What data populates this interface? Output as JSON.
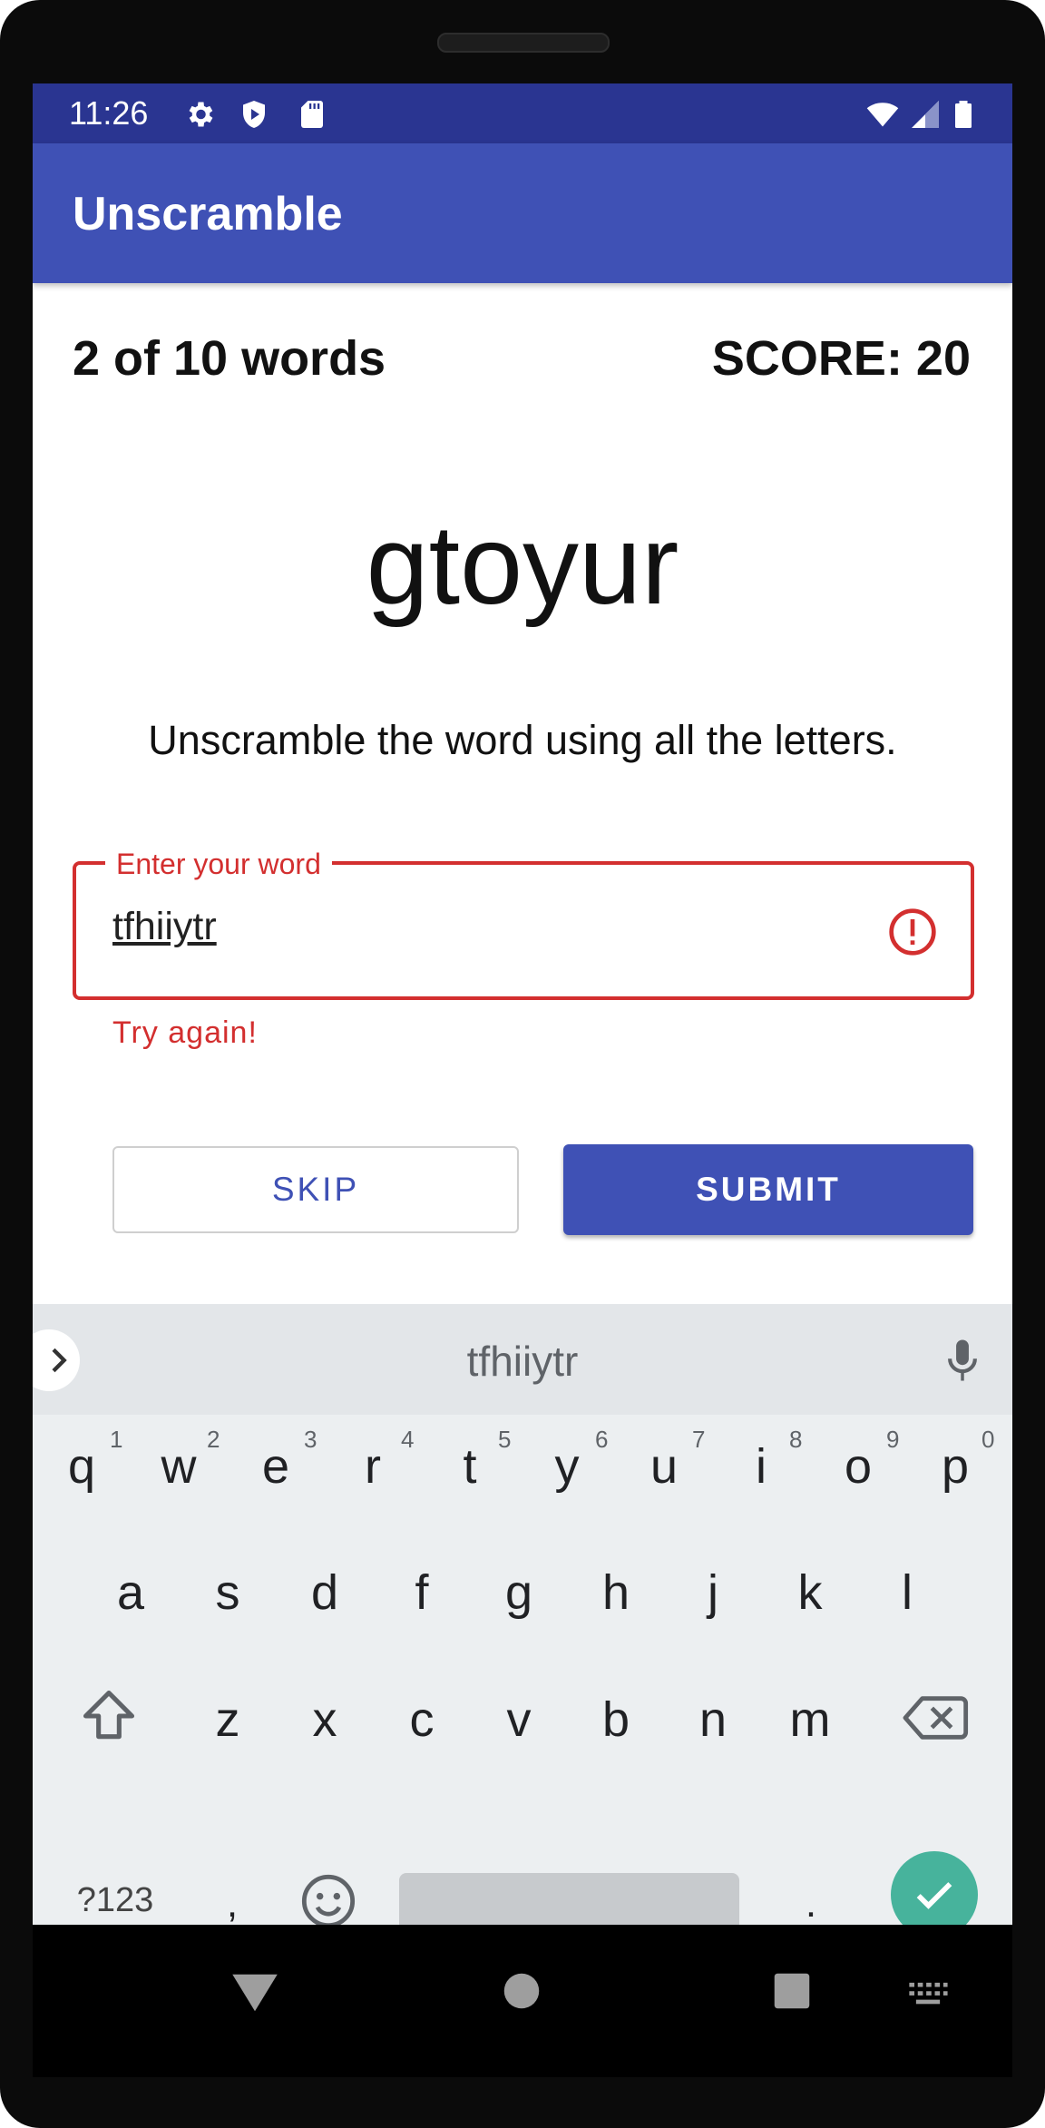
{
  "status_bar": {
    "time": "11:26",
    "icons": [
      "gear-icon",
      "shield-icon",
      "sd-card-icon",
      "wifi-icon",
      "signal-icon",
      "battery-icon"
    ]
  },
  "app": {
    "title": "Unscramble"
  },
  "game": {
    "word_count": "2 of 10 words",
    "score": "SCORE: 20",
    "scrambled_word": "gtoyur",
    "instructions": "Unscramble the word using all the letters."
  },
  "input": {
    "label": "Enter your word",
    "value": "tfhiiytr",
    "error": "Try again!"
  },
  "buttons": {
    "skip": "SKIP",
    "submit": "SUBMIT"
  },
  "keyboard": {
    "suggestion": "tfhiiytr",
    "row1": [
      "q",
      "w",
      "e",
      "r",
      "t",
      "y",
      "u",
      "i",
      "o",
      "p"
    ],
    "row1_hints": [
      "1",
      "2",
      "3",
      "4",
      "5",
      "6",
      "7",
      "8",
      "9",
      "0"
    ],
    "row2": [
      "a",
      "s",
      "d",
      "f",
      "g",
      "h",
      "j",
      "k",
      "l"
    ],
    "row3": [
      "z",
      "x",
      "c",
      "v",
      "b",
      "n",
      "m"
    ],
    "symbols_key": "?123",
    "comma_key": ",",
    "period_key": "."
  },
  "colors": {
    "primary": "#3f51b5",
    "primary_dark": "#2a3591",
    "error": "#d32f2f",
    "enter_key": "#47b39c"
  }
}
